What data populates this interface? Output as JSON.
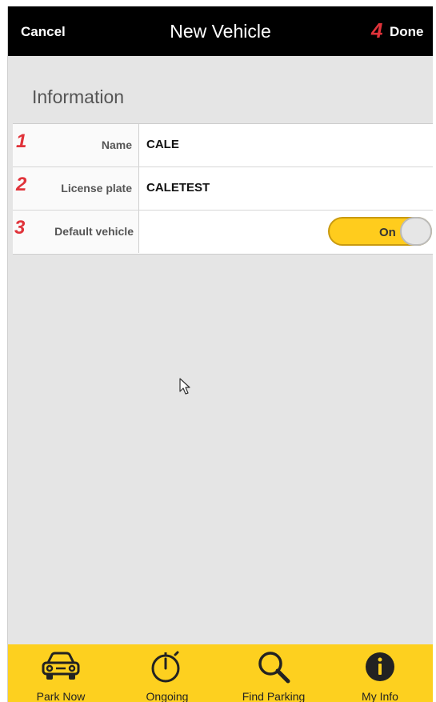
{
  "header": {
    "cancel_label": "Cancel",
    "title": "New Vehicle",
    "done_label": "Done",
    "done_marker": "4"
  },
  "section": {
    "title": "Information"
  },
  "form": {
    "rows": [
      {
        "marker": "1",
        "label": "Name",
        "value": "CALE"
      },
      {
        "marker": "2",
        "label": "License plate",
        "value": "CALETEST"
      },
      {
        "marker": "3",
        "label": "Default vehicle",
        "toggle": "On"
      }
    ]
  },
  "bottom_nav": {
    "items": [
      {
        "label": "Park Now",
        "icon": "car-icon"
      },
      {
        "label": "Ongoing",
        "icon": "stopwatch-icon"
      },
      {
        "label": "Find Parking",
        "icon": "search-icon"
      },
      {
        "label": "My Info",
        "icon": "info-icon"
      }
    ]
  },
  "colors": {
    "header_bg": "#000000",
    "accent_yellow": "#fdd01f",
    "marker_red": "#e0333a",
    "page_bg": "#e5e5e5"
  }
}
